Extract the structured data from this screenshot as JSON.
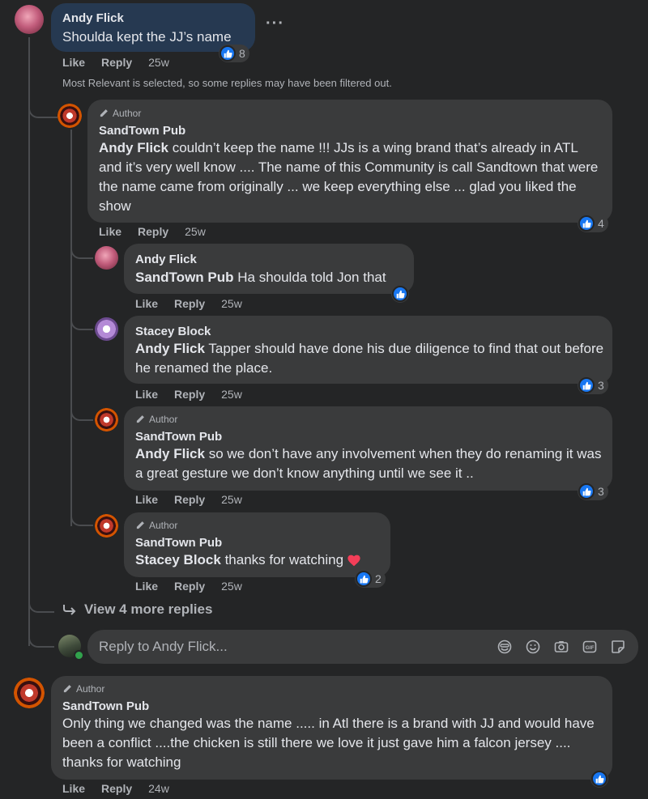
{
  "thread": {
    "info_text": "Most Relevant is selected, so some replies may have been filtered out.",
    "view_more_label": "View 4 more replies"
  },
  "comments": [
    {
      "name": "Andy Flick",
      "author_tag": "",
      "mention": "",
      "text": "Shoulda kept the JJ’s name",
      "actions": {
        "like": "Like",
        "reply": "Reply",
        "time": "25w"
      },
      "reactions": {
        "type": "like",
        "count": "8"
      }
    },
    {
      "name": "SandTown Pub",
      "author_tag": "Author",
      "mention": "Andy Flick",
      "text": " couldn’t keep the name !!! JJs is a wing brand that’s already in ATL and it’s very well know .... The name of this Community is call Sandtown that were the name came from originally ... we keep everything else ... glad you liked the show",
      "actions": {
        "like": "Like",
        "reply": "Reply",
        "time": "25w"
      },
      "reactions": {
        "type": "like",
        "count": "4"
      }
    },
    {
      "name": "Andy Flick",
      "author_tag": "",
      "mention": "SandTown Pub",
      "text": " Ha shoulda told Jon that",
      "actions": {
        "like": "Like",
        "reply": "Reply",
        "time": "25w"
      },
      "reactions": {
        "type": "like",
        "count": ""
      }
    },
    {
      "name": "Stacey Block",
      "author_tag": "",
      "mention": "Andy Flick",
      "text": " Tapper should have done his due diligence to find that out before he renamed the place.",
      "actions": {
        "like": "Like",
        "reply": "Reply",
        "time": "25w"
      },
      "reactions": {
        "type": "like",
        "count": "3"
      }
    },
    {
      "name": "SandTown Pub",
      "author_tag": "Author",
      "mention": "Andy Flick",
      "text": " so we don’t have any involvement when they do renaming it was a great gesture we don’t know anything until we see it ..",
      "actions": {
        "like": "Like",
        "reply": "Reply",
        "time": "25w"
      },
      "reactions": {
        "type": "like",
        "count": "3"
      }
    },
    {
      "name": "SandTown Pub",
      "author_tag": "Author",
      "mention": "Stacey Block",
      "text": " thanks for watching",
      "actions": {
        "like": "Like",
        "reply": "Reply",
        "time": "25w"
      },
      "reactions": {
        "type": "like+heart",
        "count": "2"
      }
    },
    {
      "name": "SandTown Pub",
      "author_tag": "Author",
      "mention": "",
      "text": "Only thing we changed was the name ..... in Atl there is a brand with JJ and would have been a conflict ....the chicken is still there we love it just gave him a falcon jersey .... thanks for watching",
      "actions": {
        "like": "Like",
        "reply": "Reply",
        "time": "24w"
      },
      "reactions": {
        "type": "like",
        "count": ""
      }
    }
  ],
  "reply_box": {
    "placeholder": "Reply to Andy Flick...",
    "tools": [
      "sticker-face-icon",
      "emoji-icon",
      "camera-icon",
      "gif-icon",
      "sticker-icon"
    ]
  },
  "colors": {
    "background": "#242526",
    "bubble": "#3a3b3c",
    "highlight_bubble": "#263951",
    "like_blue": "#1877f2",
    "heart_red": "#f33e58"
  }
}
